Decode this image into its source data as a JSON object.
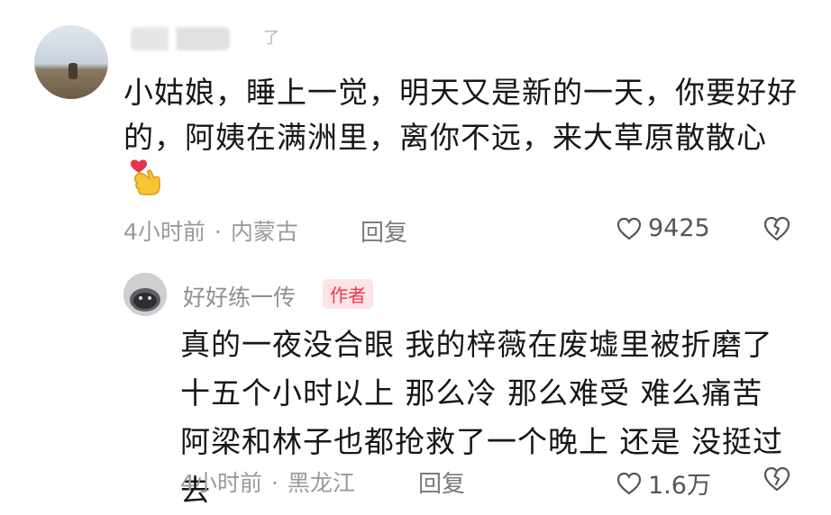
{
  "comment": {
    "username_mark": "了",
    "text": "小姑娘，睡上一觉，明天又是新的一天，你要好好的，阿姨在满洲里，离你不远，来大草原散散心",
    "emoji": "heart-finger-emoji",
    "time": "4小时前",
    "separator": "·",
    "location": "内蒙古",
    "reply_label": "回复",
    "likes": "9425"
  },
  "reply": {
    "username": "好好练一传",
    "badge": "作者",
    "text": "真的一夜没合眼 我的梓薇在废墟里被折磨了十五个小时以上 那么冷 那么难受 难么痛苦 阿梁和林子也都抢救了一个晚上 还是 没挺过去",
    "time": "4小时前",
    "separator": "·",
    "location": "黑龙江",
    "reply_label": "回复",
    "likes": "1.6万"
  },
  "colors": {
    "badge_text": "#f2344e",
    "badge_bg": "#fde3e6",
    "meta_text": "#9a9a9a"
  },
  "icons": [
    "heart-outline-icon",
    "broken-heart-icon"
  ]
}
